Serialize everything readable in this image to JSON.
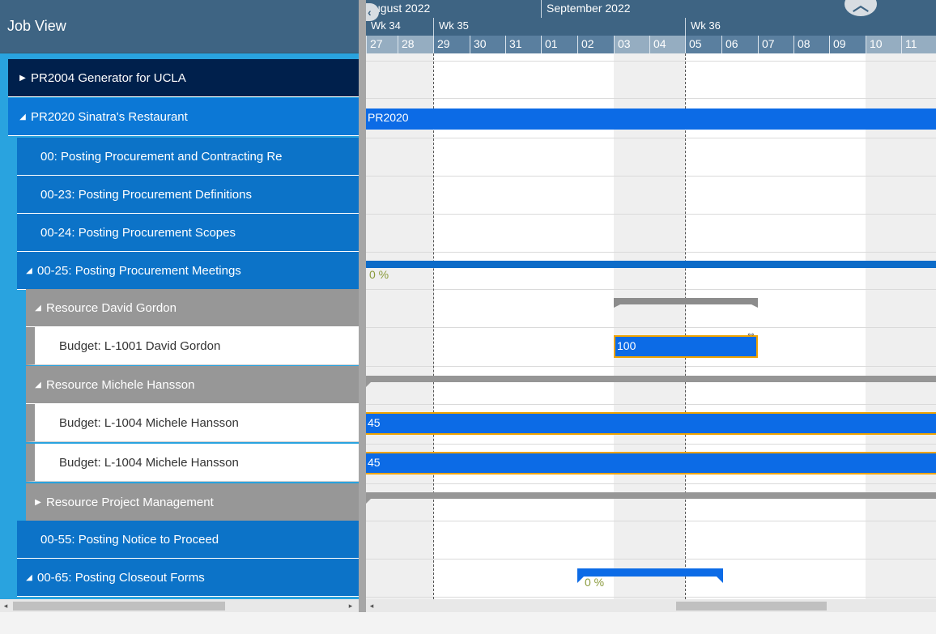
{
  "left_header": {
    "title": "Job View"
  },
  "rows": [
    {
      "arrow": "▶",
      "label": "PR2004 Generator for UCLA"
    },
    {
      "arrow": "◢",
      "label": "PR2020 Sinatra's Restaurant"
    },
    {
      "arrow": "",
      "label": "00: Posting Procurement and Contracting Re"
    },
    {
      "arrow": "",
      "label": "00-23: Posting Procurement Definitions"
    },
    {
      "arrow": "",
      "label": "00-24: Posting Procurement Scopes"
    },
    {
      "arrow": "◢",
      "label": "00-25: Posting Procurement Meetings"
    },
    {
      "arrow": "◢",
      "label": "Resource David Gordon"
    },
    {
      "arrow": "",
      "label": "Budget: L-1001 David Gordon"
    },
    {
      "arrow": "◢",
      "label": "Resource Michele Hansson"
    },
    {
      "arrow": "",
      "label": "Budget: L-1004 Michele Hansson"
    },
    {
      "arrow": "",
      "label": "Budget: L-1004 Michele Hansson"
    },
    {
      "arrow": "▶",
      "label": "Resource Project Management"
    },
    {
      "arrow": "",
      "label": "00-55: Posting Notice to Proceed"
    },
    {
      "arrow": "◢",
      "label": "00-65: Posting Closeout Forms"
    }
  ],
  "timeline": {
    "months": [
      "ugust 2022",
      "September 2022"
    ],
    "weeks": [
      "Wk 34",
      "Wk 35",
      "Wk 36"
    ],
    "days": [
      "27",
      "28",
      "29",
      "30",
      "31",
      "01",
      "02",
      "03",
      "04",
      "05",
      "06",
      "07",
      "08",
      "09",
      "10",
      "11"
    ],
    "weekend_days": [
      "27",
      "28",
      "03",
      "04",
      "10",
      "11"
    ],
    "collapse_glyph": "︿",
    "back_glyph": "‹"
  },
  "bars": {
    "project_label": "PR2020",
    "david_budget": "100",
    "michele_budget_1": "45",
    "michele_budget_2": "45",
    "pct_meetings": "0 %",
    "pct_closeout": "0 %"
  },
  "scroll": {
    "left_arrow": "◂",
    "right_arrow": "▸"
  },
  "colors": {
    "header": "#3e6483",
    "bar_blue": "#0c6be6",
    "bar_outline": "#f0a400",
    "resource_gray": "#979797",
    "percent_text": "#8a9a3c"
  }
}
